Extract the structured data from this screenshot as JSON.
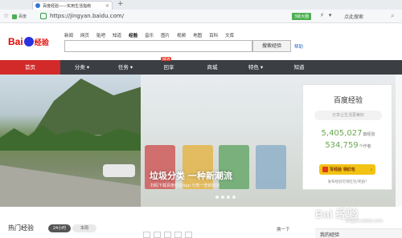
{
  "browser": {
    "tab_title": "百度经验——实用生活指南",
    "new_tab": "+",
    "site_tag": "百度",
    "url": "https://jingyan.baidu.com/",
    "ext_badge": "3就大圈",
    "search_label": "点此搜索"
  },
  "header": {
    "logo_bai": "Bai",
    "logo_jy": "经验",
    "nav": [
      "新闻",
      "网页",
      "贴吧",
      "知道",
      "经验",
      "音乐",
      "图片",
      "视频",
      "地图",
      "百科",
      "文库"
    ],
    "nav_active": "经验",
    "search_placeholder": "",
    "search_button": "搜索经验",
    "help_link": "帮助"
  },
  "categories": {
    "items": [
      "首页",
      "分类 ▾",
      "任务 ▾",
      "回享",
      "商城",
      "特色 ▾",
      "知道"
    ],
    "new_badge": "NEW"
  },
  "banner": {
    "overlay_title": "垃圾分类 一种新潮流",
    "overlay_sub": "扫码下载百度经验App 分类一查就知道"
  },
  "card": {
    "title": "百度经验",
    "slogan": "分享让生活更美好",
    "stat1_value": "5,405,027",
    "stat1_unit": "篇经验",
    "stat2_value": "534,759",
    "stat2_unit": "个作者",
    "cta": "写经验 领红包",
    "howto": "发布经验可领红包/奖励？"
  },
  "bottom": {
    "hot_title": "热门经验",
    "pill_24h": "24小时",
    "pill_week": "本周",
    "refresh": "换一下",
    "my_jy": "我的经验",
    "watermark": "Bai 经验",
    "watermark_sub": "jingyan.baidu.com"
  },
  "colors": {
    "brand_red": "#d22a29",
    "category_bar": "#3b3f43",
    "accent_green": "#6aa84f",
    "cta_yellow": "#f2c312"
  }
}
